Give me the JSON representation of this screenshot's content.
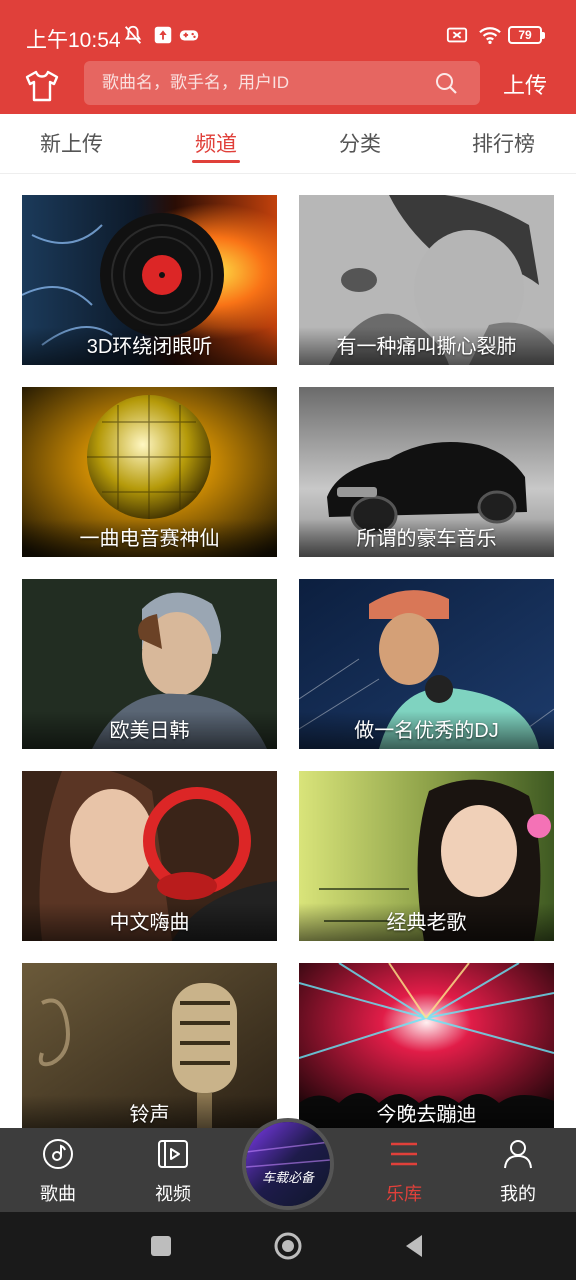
{
  "status_bar": {
    "time": "上午10:54",
    "battery": "79",
    "icons": [
      "silent-bell-icon",
      "upload-box-icon",
      "gamepad-icon",
      "no-sim-icon",
      "wifi-icon",
      "battery-icon"
    ]
  },
  "app_bar": {
    "shirt_icon": "tshirt-icon",
    "search_placeholder": "歌曲名，歌手名，用户ID",
    "search_icon": "search-icon",
    "upload_label": "上传"
  },
  "tabs": [
    {
      "label": "新上传",
      "active": false
    },
    {
      "label": "频道",
      "active": true
    },
    {
      "label": "分类",
      "active": false
    },
    {
      "label": "排行榜",
      "active": false
    }
  ],
  "channels": [
    {
      "title": "3D环绕闭眼听"
    },
    {
      "title": "有一种痛叫撕心裂肺"
    },
    {
      "title": "一曲电音赛神仙"
    },
    {
      "title": "所谓的豪车音乐"
    },
    {
      "title": "欧美日韩"
    },
    {
      "title": "做一名优秀的DJ"
    },
    {
      "title": "中文嗨曲"
    },
    {
      "title": "经典老歌"
    },
    {
      "title": "铃声"
    },
    {
      "title": "今晚去蹦迪"
    }
  ],
  "bottom_nav": [
    {
      "label": "歌曲",
      "icon": "disc-icon",
      "active": false
    },
    {
      "label": "视频",
      "icon": "video-icon",
      "active": false
    },
    {
      "label": "乐库",
      "icon": "library-menu-icon",
      "active": true
    },
    {
      "label": "我的",
      "icon": "user-icon",
      "active": false
    }
  ],
  "center_disc_text": "车载必备",
  "colors": {
    "brand_red": "#e0403a",
    "nav_bg": "#3d3d3d",
    "system_nav_bg": "#1a1a1a"
  }
}
